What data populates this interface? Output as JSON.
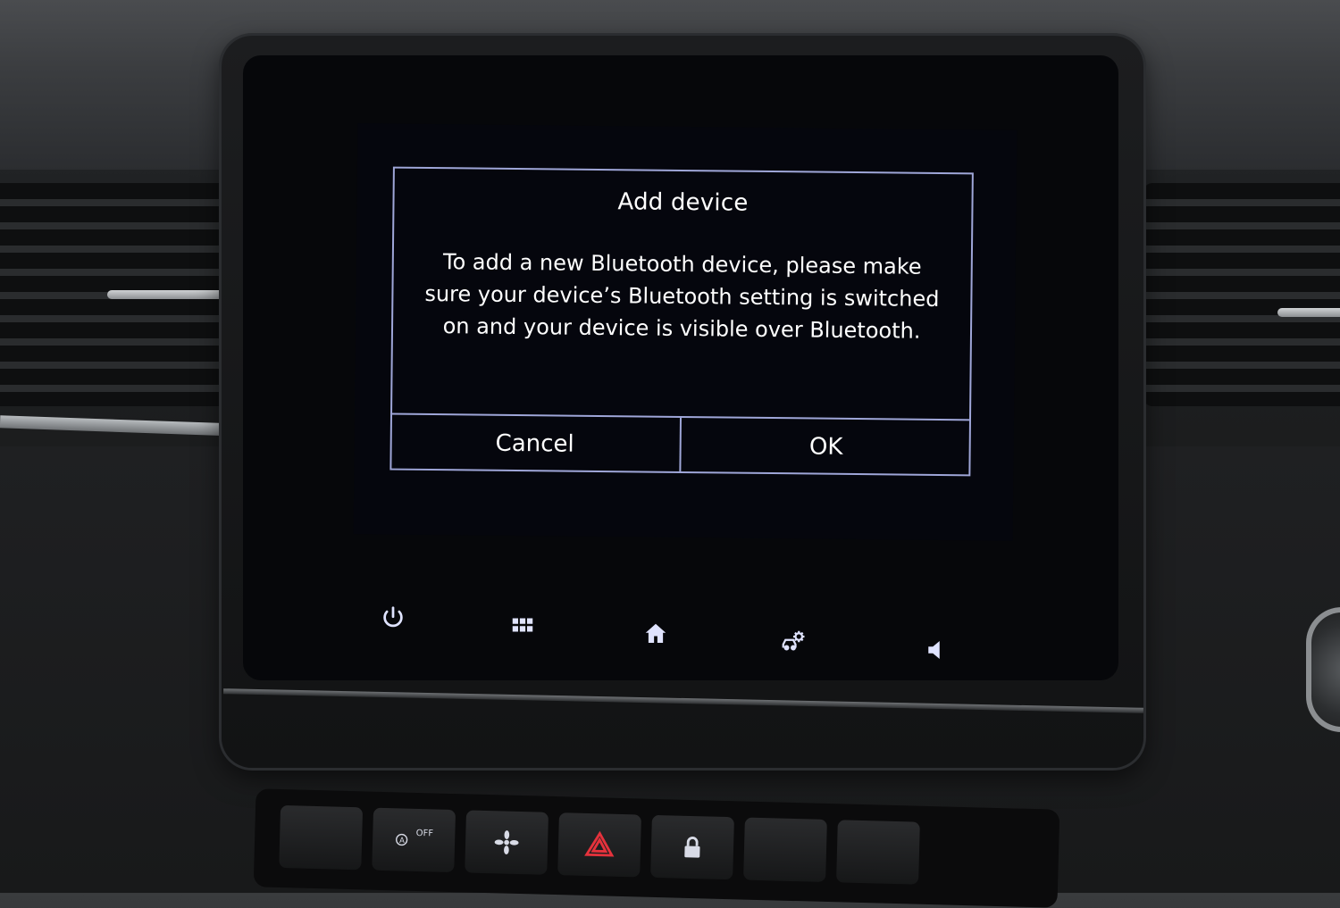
{
  "dialog": {
    "title": "Add device",
    "message": "To add a new Bluetooth device, please make sure your device’s Bluetooth setting is switched on and your device is visible over Bluetooth.",
    "cancel_label": "Cancel",
    "ok_label": "OK"
  },
  "touchbar": {
    "icons": [
      "power-icon",
      "apps-grid-icon",
      "home-icon",
      "vehicle-settings-icon",
      "volume-icon"
    ]
  },
  "hardware_buttons": {
    "auto_stop_label": "OFF"
  },
  "colors": {
    "dialog_border": "#9fa6d8",
    "screen_background": "#05060d",
    "text": "#ffffff",
    "icon": "#dfe3ff",
    "hazard": "#e5323c"
  }
}
